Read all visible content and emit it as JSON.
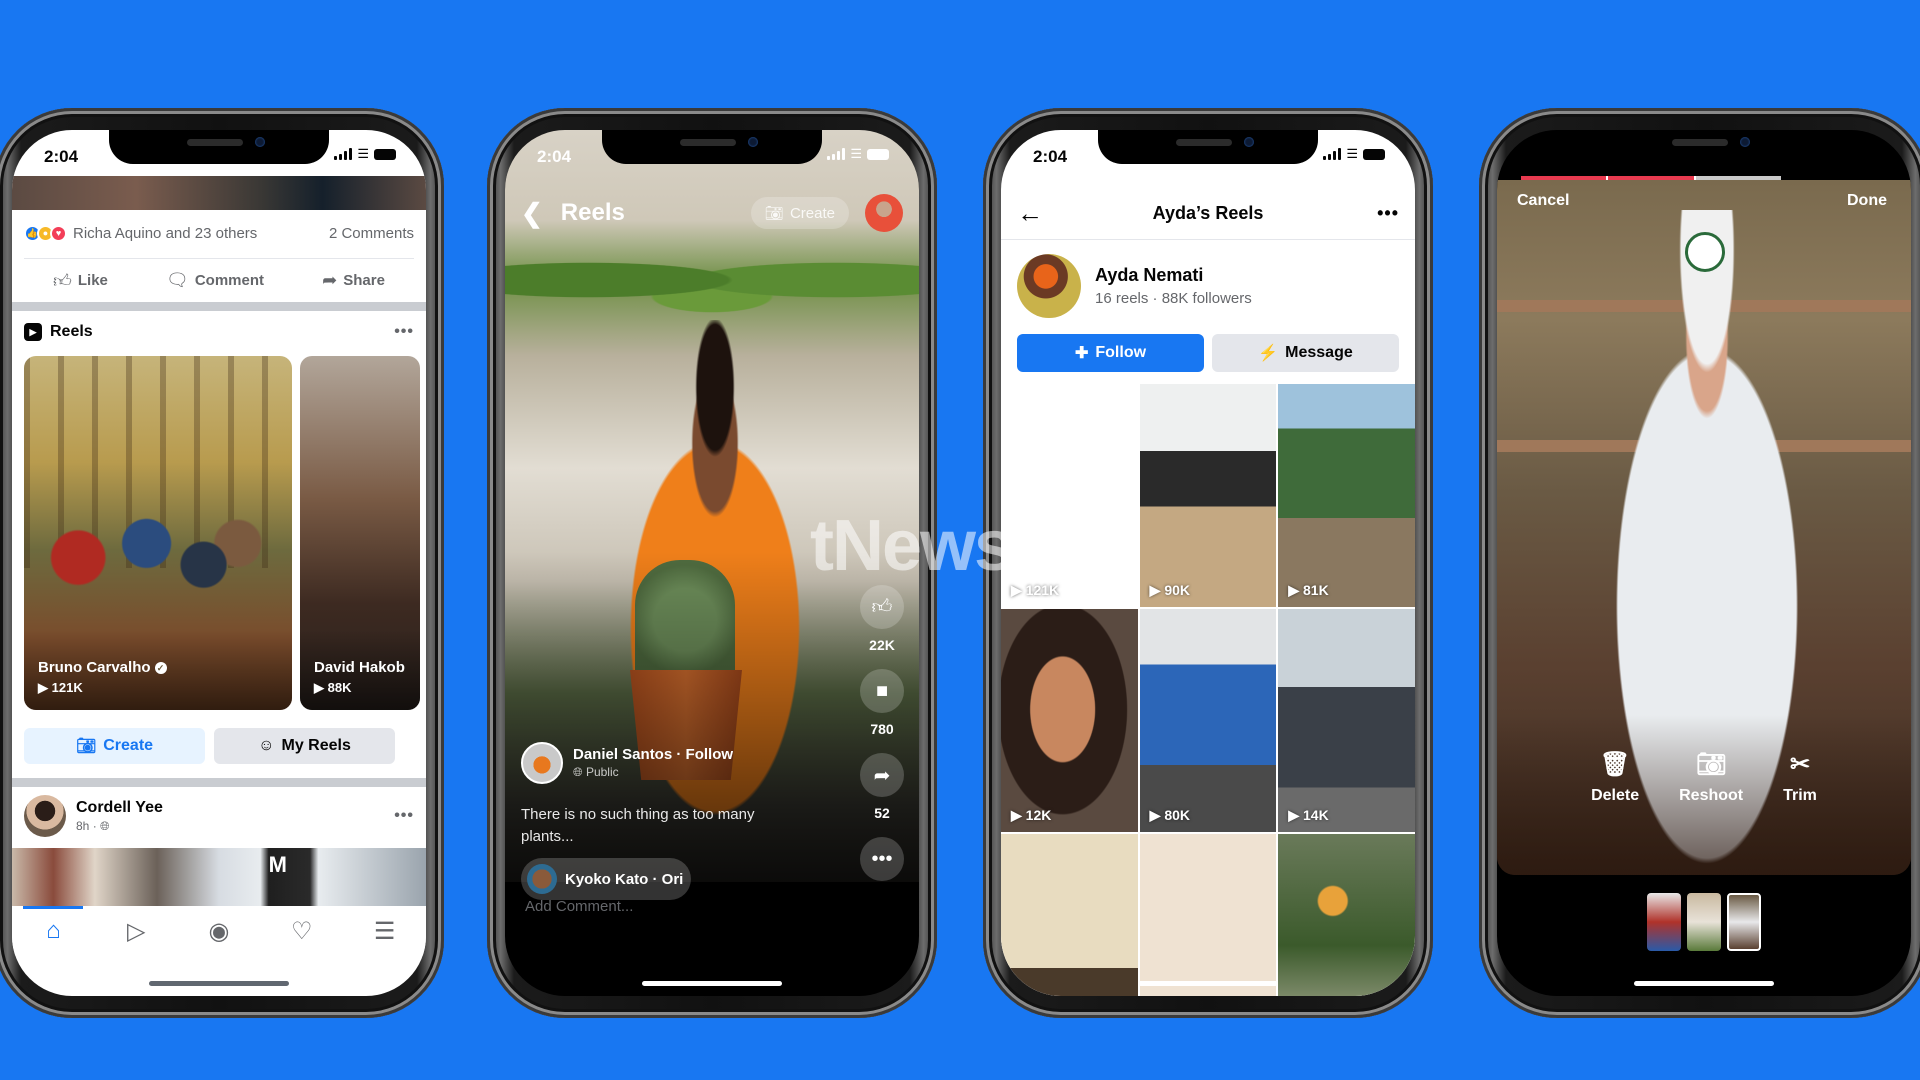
{
  "background_color": "#1877F2",
  "watermark": "tNews.id",
  "phones": {
    "feed": {
      "status_time": "2:04",
      "reactions": {
        "types": [
          "like",
          "wow",
          "love"
        ],
        "summary": "Richa Aquino and 23 others",
        "comments": "2 Comments"
      },
      "actions": [
        {
          "icon": "like-icon",
          "label": "Like"
        },
        {
          "icon": "comment-icon",
          "label": "Comment"
        },
        {
          "icon": "share-icon",
          "label": "Share"
        }
      ],
      "reels_section": {
        "title": "Reels",
        "cards": [
          {
            "author": "Bruno Carvalho",
            "verified": true,
            "views": "121K"
          },
          {
            "author": "David Hakob",
            "verified": false,
            "views": "88K"
          }
        ],
        "create_label": "Create",
        "my_reels_label": "My Reels"
      },
      "next_post": {
        "author": "Cordell Yee",
        "time": "8h",
        "audience": "public"
      },
      "tabbar": [
        "home",
        "watch",
        "groups",
        "notifications",
        "menu"
      ],
      "active_tab": "home"
    },
    "reel_viewer": {
      "status_time": "2:04",
      "title": "Reels",
      "create_label": "Create",
      "author": "Daniel Santos",
      "follow_label": "Follow",
      "audience": "Public",
      "caption": "There is no such thing as too many plants...",
      "audio_label": "Kyoko Kato · Ori",
      "likes": "22K",
      "comments": "780",
      "shares": "52",
      "comment_placeholder": "Add Comment..."
    },
    "profile_reels": {
      "status_time": "2:04",
      "title": "Ayda’s Reels",
      "name": "Ayda Nemati",
      "stats": "16 reels · 88K followers",
      "follow_label": "Follow",
      "message_label": "Message",
      "grid": [
        {
          "views": "121K"
        },
        {
          "views": "90K"
        },
        {
          "views": "81K"
        },
        {
          "views": "12K"
        },
        {
          "views": "80K"
        },
        {
          "views": "14K"
        },
        {
          "views": ""
        },
        {
          "views": ""
        },
        {
          "views": ""
        }
      ]
    },
    "editor": {
      "cancel_label": "Cancel",
      "done_label": "Done",
      "progress_segments": 3,
      "progress_recorded_segments": 2,
      "tools": [
        {
          "icon": "trash-icon",
          "label": "Delete"
        },
        {
          "icon": "camera-icon",
          "label": "Reshoot"
        },
        {
          "icon": "scissors-icon",
          "label": "Trim"
        }
      ],
      "clips": 3,
      "selected_clip": 3
    }
  }
}
